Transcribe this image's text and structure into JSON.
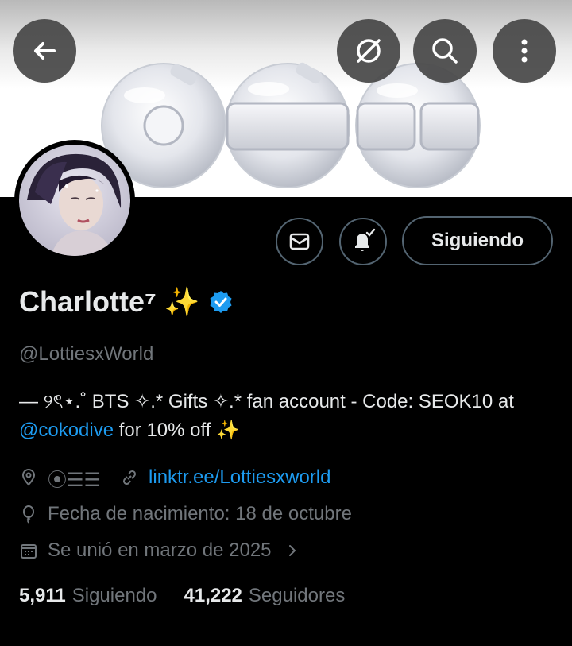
{
  "header": {
    "back_icon": "arrow-left-icon",
    "actions": [
      "hide-icon",
      "search-icon",
      "more-vertical-icon"
    ]
  },
  "profile": {
    "name": "Charlotte⁷ ✨",
    "verified": true,
    "handle": "@LottiesxWorld",
    "bio_part1": "— ୨ৎ⋆.˚ BTS ✧.* Gifts ✧.* fan account - Code: SEOK10 at",
    "bio_mention": "@cokodive",
    "bio_part2": "for 10% off ✨",
    "location": "⦿☰☰",
    "website": "linktr.ee/Lottiesxworld",
    "birthday": "Fecha de nacimiento: 18 de octubre",
    "joined": "Se unió en marzo de 2025",
    "following_count": "5,911",
    "following_label": "Siguiendo",
    "followers_count": "41,222",
    "followers_label": "Seguidores"
  },
  "actions": {
    "follow_label": "Siguiendo"
  },
  "colors": {
    "background": "#000000",
    "accent_link": "#1d9bf0",
    "muted_text": "#71767b",
    "primary_text": "#e7e9ea",
    "border": "#536471",
    "verified": "#1d9bf0"
  }
}
